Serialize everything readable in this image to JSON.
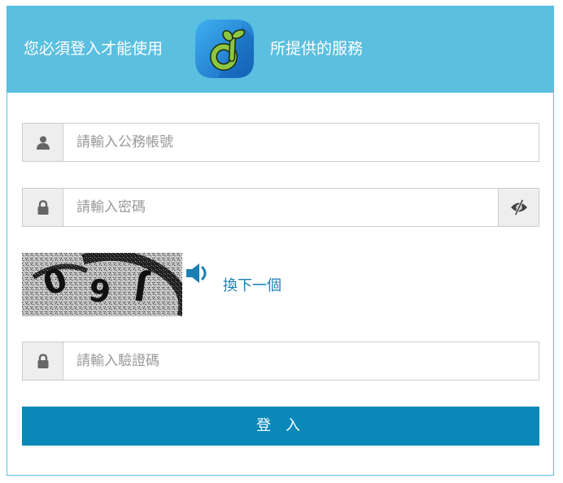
{
  "header": {
    "title_left": "您必須登入才能使用",
    "title_right": "所提供的服務",
    "logo_icon": "sprout-logo-icon",
    "background_color": "#5bbfe0"
  },
  "form": {
    "account": {
      "placeholder": "請輸入公務帳號",
      "value": "",
      "icon": "user-icon"
    },
    "password": {
      "placeholder": "請輸入密碼",
      "value": "",
      "icon": "lock-icon",
      "toggle_icon": "eye-slash-icon"
    },
    "captcha": {
      "image_text": "09J",
      "audio_icon": "speaker-icon",
      "refresh_label": "換下一個"
    },
    "captcha_input": {
      "placeholder": "請輸入驗證碼",
      "value": "",
      "icon": "lock-icon"
    },
    "submit_label": "登 入",
    "submit_color": "#0a88b8",
    "link_color": "#1b7fb4"
  }
}
